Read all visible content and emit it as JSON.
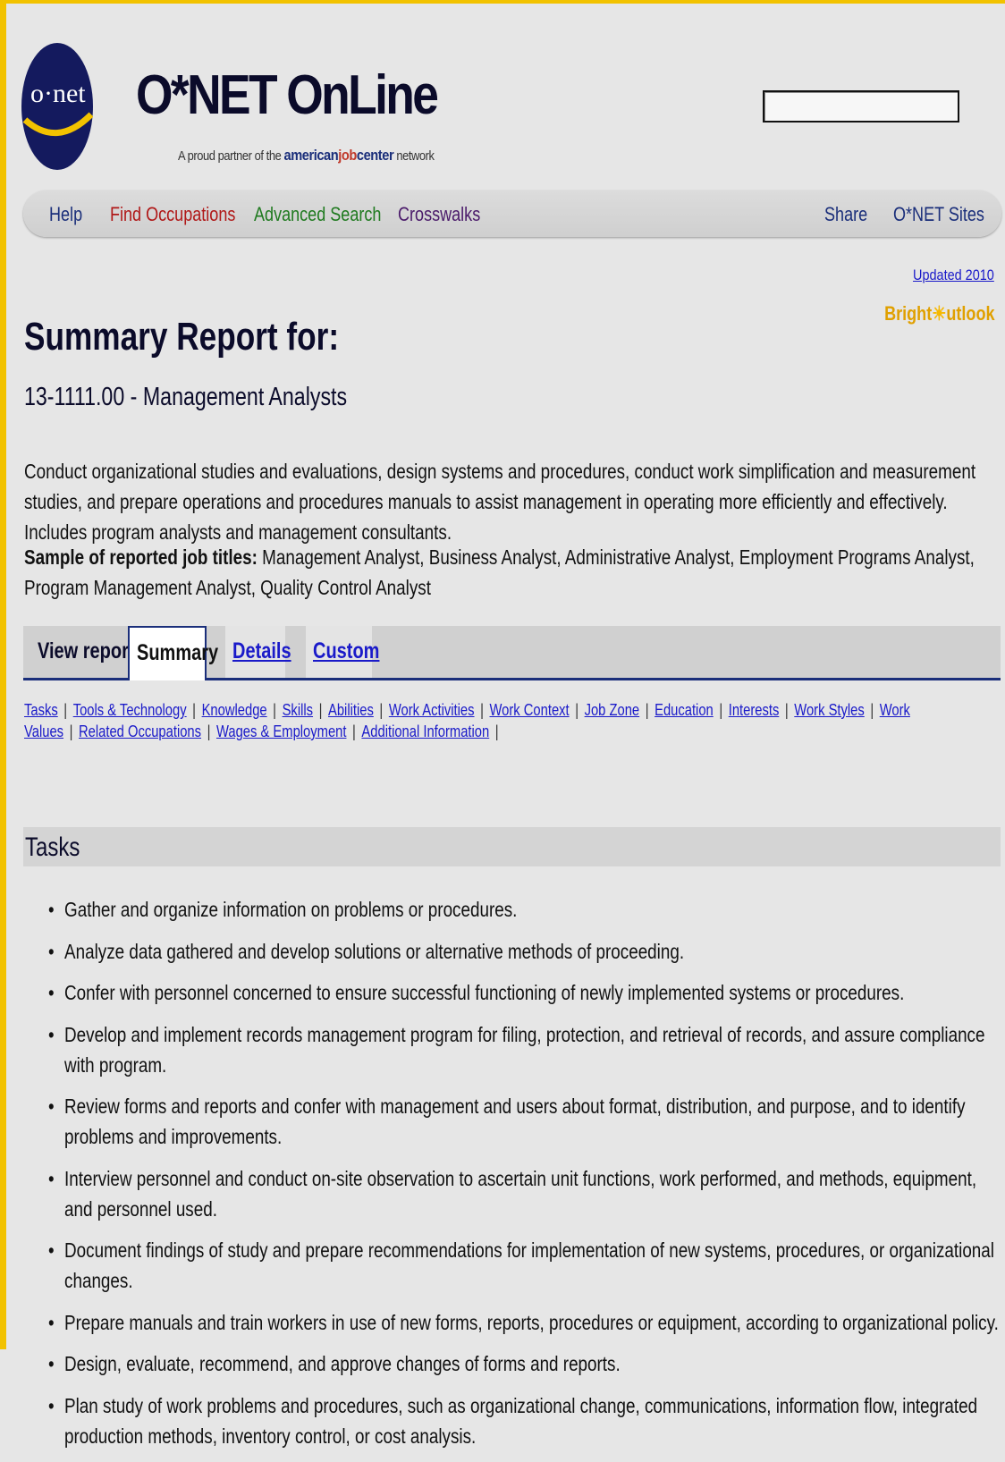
{
  "header": {
    "logo_text": "o·net",
    "brand": "O*NET OnLine",
    "tagline_prefix": "A proud partner of the",
    "ajc_part1": "american",
    "ajc_part2": "job",
    "ajc_part3": "center",
    "tagline_suffix": "network"
  },
  "nav": [
    {
      "label": "Help"
    },
    {
      "label": "Find Occupations"
    },
    {
      "label": "Advanced Search"
    },
    {
      "label": "Crosswalks"
    },
    {
      "label": "Share"
    },
    {
      "label": "O*NET Sites"
    }
  ],
  "meta": {
    "updated": "Updated 2010",
    "bright_a": "Bright",
    "bright_b": "utlook"
  },
  "report": {
    "title": "Summary Report for:",
    "occupation": "13-1111.00 - Management Analysts",
    "description": "Conduct organizational studies and evaluations, design systems and procedures, conduct work simplification and measurement studies, and prepare operations and procedures manuals to assist management in operating more efficiently and effectively. Includes program analysts and management consultants.",
    "sample_label": "Sample of reported job titles:",
    "sample_titles": "Management Analyst, Business Analyst, Administrative Analyst, Employment Programs Analyst, Program Management Analyst, Quality Control Analyst"
  },
  "view_report": {
    "label": "View report:",
    "tabs": [
      "Summary",
      "Details",
      "Custom"
    ]
  },
  "sections": [
    "Tasks",
    "Tools & Technology",
    "Knowledge",
    "Skills",
    "Abilities",
    "Work Activities",
    "Work Context",
    "Job Zone",
    "Education",
    "Interests",
    "Work Styles",
    "Work Values",
    "Related Occupations",
    "Wages & Employment",
    "Additional Information"
  ],
  "tasks": {
    "heading": "Tasks",
    "items": [
      "Gather and organize information on problems or procedures.",
      "Analyze data gathered and develop solutions or alternative methods of proceeding.",
      "Confer with personnel concerned to ensure successful functioning of newly implemented systems or procedures.",
      "Develop and implement records management program for filing, protection, and retrieval of records, and assure compliance with program.",
      "Review forms and reports and confer with management and users about format, distribution, and purpose, and to identify problems and improvements.",
      "Interview personnel and conduct on-site observation to ascertain unit functions, work performed, and methods, equipment, and personnel used.",
      "Document findings of study and prepare recommendations for implementation of new systems, procedures, or organizational changes.",
      "Prepare manuals and train workers in use of new forms, reports, procedures or equipment, according to organizational policy.",
      "Design, evaluate, recommend, and approve changes of forms and reports.",
      "Plan study of work problems and procedures, such as organizational change, communications, information flow, integrated production methods, inventory control, or cost analysis."
    ]
  }
}
